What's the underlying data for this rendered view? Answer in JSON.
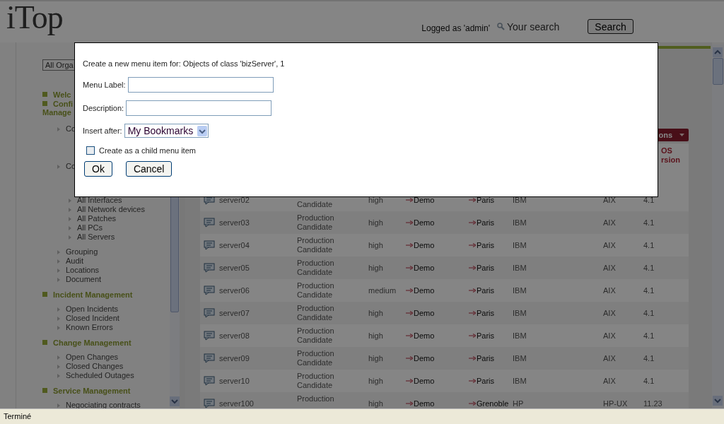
{
  "header": {
    "logo": "iTop",
    "logged_as": "Logged as 'admin'",
    "search": {
      "placeholder": "Your search"
    },
    "search_button": "Search"
  },
  "sidebar": {
    "org_filter": "All Orga",
    "groups": [
      {
        "title": "Welc"
      },
      {
        "title": "Confi",
        "title_continued": "Manage",
        "children": [
          {
            "label": "Co"
          },
          {
            "label": "Co",
            "children": [
              {
                "label": "All Interfaces"
              },
              {
                "label": "All Network devices"
              },
              {
                "label": "All Patches"
              },
              {
                "label": "All PCs"
              },
              {
                "label": "All Servers"
              }
            ]
          },
          {
            "label": "Grouping"
          },
          {
            "label": "Audit"
          },
          {
            "label": "Locations"
          },
          {
            "label": "Document"
          }
        ]
      },
      {
        "title": "Incident Management",
        "children": [
          {
            "label": "Open Incidents"
          },
          {
            "label": "Closed Incident"
          },
          {
            "label": "Known Errors"
          }
        ]
      },
      {
        "title": "Change Management",
        "children": [
          {
            "label": "Open Changes"
          },
          {
            "label": "Closed Changes"
          },
          {
            "label": "Scheduled Outages"
          }
        ]
      },
      {
        "title": "Service Management",
        "children": [
          {
            "label": "Negociating contracts"
          }
        ]
      }
    ]
  },
  "content": {
    "actions_button": "ons",
    "table": {
      "column_header": [
        "OS",
        "rsion"
      ],
      "rows": [
        {
          "name": "server02",
          "status": {
            "lower": "Candidate"
          },
          "importance": "high",
          "organization": "Demo",
          "location": "Paris",
          "brand": "IBM",
          "os_family": "AIX",
          "os_version": "4.1"
        },
        {
          "name": "server03",
          "status": {
            "upper": "Production",
            "lower": "Candidate"
          },
          "importance": "high",
          "organization": "Demo",
          "location": "Paris",
          "brand": "IBM",
          "os_family": "AIX",
          "os_version": "4.1"
        },
        {
          "name": "server04",
          "status": {
            "upper": "Production",
            "lower": "Candidate"
          },
          "importance": "high",
          "organization": "Demo",
          "location": "Paris",
          "brand": "IBM",
          "os_family": "AIX",
          "os_version": "4.1"
        },
        {
          "name": "server05",
          "status": {
            "upper": "Production",
            "lower": "Candidate"
          },
          "importance": "high",
          "organization": "Demo",
          "location": "Paris",
          "brand": "IBM",
          "os_family": "AIX",
          "os_version": "4.1"
        },
        {
          "name": "server06",
          "status": {
            "upper": "Production",
            "lower": "Candidate"
          },
          "importance": "medium",
          "organization": "Demo",
          "location": "Paris",
          "brand": "IBM",
          "os_family": "AIX",
          "os_version": "4.1"
        },
        {
          "name": "server07",
          "status": {
            "upper": "Production",
            "lower": "Candidate"
          },
          "importance": "high",
          "organization": "Demo",
          "location": "Paris",
          "brand": "IBM",
          "os_family": "AIX",
          "os_version": "4.1"
        },
        {
          "name": "server08",
          "status": {
            "upper": "Production",
            "lower": "Candidate"
          },
          "importance": "high",
          "organization": "Demo",
          "location": "Paris",
          "brand": "IBM",
          "os_family": "AIX",
          "os_version": "4.1"
        },
        {
          "name": "server09",
          "status": {
            "upper": "Production",
            "lower": "Candidate"
          },
          "importance": "high",
          "organization": "Demo",
          "location": "Paris",
          "brand": "IBM",
          "os_family": "AIX",
          "os_version": "4.1"
        },
        {
          "name": "server10",
          "status": {
            "upper": "Production",
            "lower": "Candidate"
          },
          "importance": "high",
          "organization": "Demo",
          "location": "Paris",
          "brand": "IBM",
          "os_family": "AIX",
          "os_version": "4.1"
        },
        {
          "name": "server100",
          "status": {
            "upper": "Production"
          },
          "importance": "high",
          "organization": "Demo",
          "location": "Grenoble",
          "brand": "HP",
          "os_family": "HP-UX",
          "os_version": "11.23"
        }
      ]
    }
  },
  "dialog": {
    "intro": "Create a new menu item for: Objects of class 'bizServer', 1",
    "fields": [
      {
        "kind": "text",
        "label": "Menu Label:"
      },
      {
        "kind": "text",
        "label": "Description:"
      },
      {
        "kind": "select",
        "label": "Insert after:",
        "value": "My Bookmarks"
      }
    ],
    "child_option": {
      "label": "Create as a child menu item",
      "checked": false
    },
    "buttons": [
      "Ok",
      "Cancel"
    ]
  },
  "status_bar": "Terminé"
}
